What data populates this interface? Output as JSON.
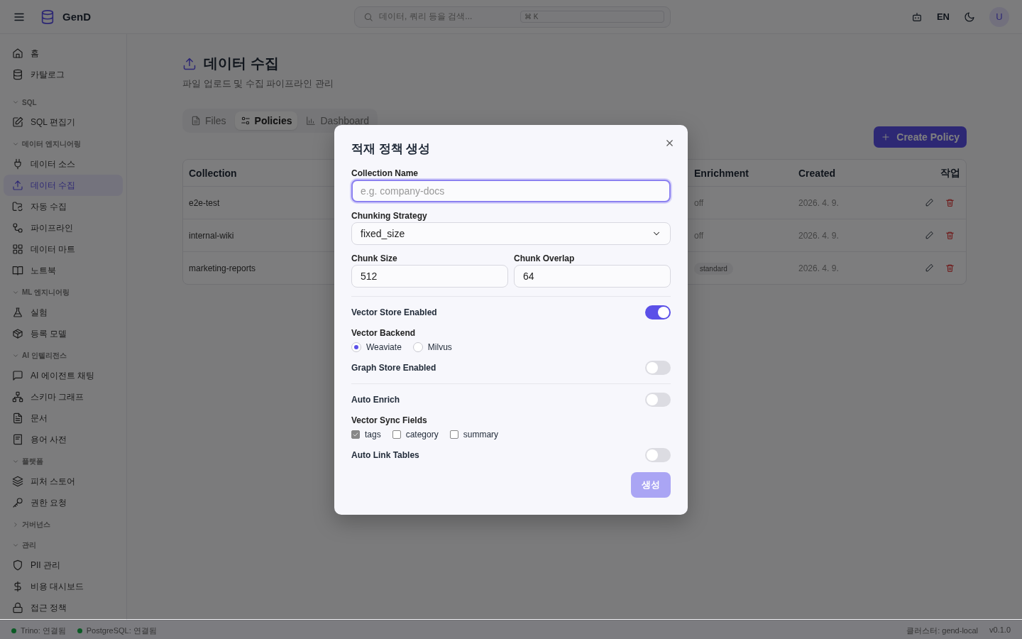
{
  "topbar": {
    "brand": "GenD",
    "search": {
      "placeholder": "데이터, 쿼리 등을 검색...",
      "shortcut": "⌘ K"
    },
    "language": "EN",
    "avatar": "U"
  },
  "sidebar": {
    "groups": [
      {
        "items": [
          {
            "label": "홈",
            "selected": false
          },
          {
            "label": "카탈로그",
            "selected": false
          }
        ]
      },
      {
        "label": "SQL",
        "expanded": true,
        "items": [
          {
            "label": "SQL 편집기",
            "selected": false
          }
        ]
      },
      {
        "label": "데이터 엔지니어링",
        "expanded": true,
        "items": [
          {
            "label": "데이터 소스",
            "selected": false
          },
          {
            "label": "데이터 수집",
            "selected": true
          },
          {
            "label": "자동 수집",
            "selected": false
          },
          {
            "label": "파이프라인",
            "selected": false
          },
          {
            "label": "데이터 마트",
            "selected": false
          },
          {
            "label": "노트북",
            "selected": false
          }
        ]
      },
      {
        "label": "ML 엔지니어링",
        "expanded": true,
        "items": [
          {
            "label": "실험",
            "selected": false
          },
          {
            "label": "등록 모델",
            "selected": false
          }
        ]
      },
      {
        "label": "AI 인텔리전스",
        "expanded": true,
        "items": [
          {
            "label": "AI 에이전트 채팅",
            "selected": false
          },
          {
            "label": "스키마 그래프",
            "selected": false
          },
          {
            "label": "문서",
            "selected": false
          },
          {
            "label": "용어 사전",
            "selected": false
          }
        ]
      },
      {
        "label": "플랫폼",
        "expanded": true,
        "items": [
          {
            "label": "피처 스토어",
            "selected": false
          },
          {
            "label": "권한 요청",
            "selected": false
          }
        ]
      },
      {
        "label": "거버넌스",
        "expanded": false
      },
      {
        "label": "관리",
        "expanded": true,
        "items": [
          {
            "label": "PII 관리",
            "selected": false
          },
          {
            "label": "비용 대시보드",
            "selected": false
          },
          {
            "label": "접근 정책",
            "selected": false
          }
        ]
      }
    ]
  },
  "page": {
    "title": "데이터 수집",
    "subtitle": "파일 업로드 및 수집 파이프라인 관리",
    "tabs": [
      {
        "label": "Files",
        "selected": false
      },
      {
        "label": "Policies",
        "selected": true
      },
      {
        "label": "Dashboard",
        "selected": false
      }
    ],
    "create_button": "Create Policy",
    "table": {
      "columns": [
        "Collection",
        "Enrichment",
        "Created",
        "작업"
      ],
      "rows": [
        {
          "collection": "e2e-test",
          "enrichment": {
            "text": "off",
            "kind": "plain"
          },
          "created": "2026. 4. 9."
        },
        {
          "collection": "internal-wiki",
          "enrichment": {
            "text": "off",
            "kind": "plain"
          },
          "created": "2026. 4. 9."
        },
        {
          "collection": "marketing-reports",
          "enrichment": {
            "text": "standard",
            "kind": "badge"
          },
          "created": "2026. 4. 9."
        }
      ]
    }
  },
  "dialog": {
    "title": "적재 정책 생성",
    "fields": [
      {
        "kind": "text",
        "label": "Collection Name",
        "placeholder": "e.g. company-docs",
        "focused": true
      },
      {
        "kind": "select",
        "label": "Chunking Strategy",
        "value": "fixed_size"
      },
      {
        "kind": "pair",
        "items": [
          {
            "label": "Chunk Size",
            "value": "512"
          },
          {
            "label": "Chunk Overlap",
            "value": "64"
          }
        ]
      },
      {
        "kind": "toggle",
        "label": "Vector Store Enabled",
        "on": true,
        "separated": true
      },
      {
        "kind": "radio",
        "label": "Vector Backend",
        "options": [
          {
            "label": "Weaviate",
            "selected": true
          },
          {
            "label": "Milvus",
            "selected": false
          }
        ]
      },
      {
        "kind": "toggle",
        "label": "Graph Store Enabled",
        "on": false,
        "separated": false
      },
      {
        "kind": "toggle",
        "label": "Auto Enrich",
        "on": false,
        "separated": true
      },
      {
        "kind": "checks",
        "label": "Vector Sync Fields",
        "options": [
          {
            "label": "tags",
            "checked": true
          },
          {
            "label": "category",
            "checked": false
          },
          {
            "label": "summary",
            "checked": false
          }
        ]
      },
      {
        "kind": "toggle",
        "label": "Auto Link Tables",
        "on": false,
        "separated": false
      }
    ],
    "submit": {
      "label": "생성",
      "disabled": true
    }
  },
  "status_bar": {
    "connections": [
      {
        "label": "Trino: 연결됨",
        "color": "#0b5a25"
      },
      {
        "label": "PostgreSQL: 연결됨",
        "color": "#0b5a25"
      }
    ],
    "cluster": "클러스터: gend-local",
    "version": "v0.1.0"
  }
}
